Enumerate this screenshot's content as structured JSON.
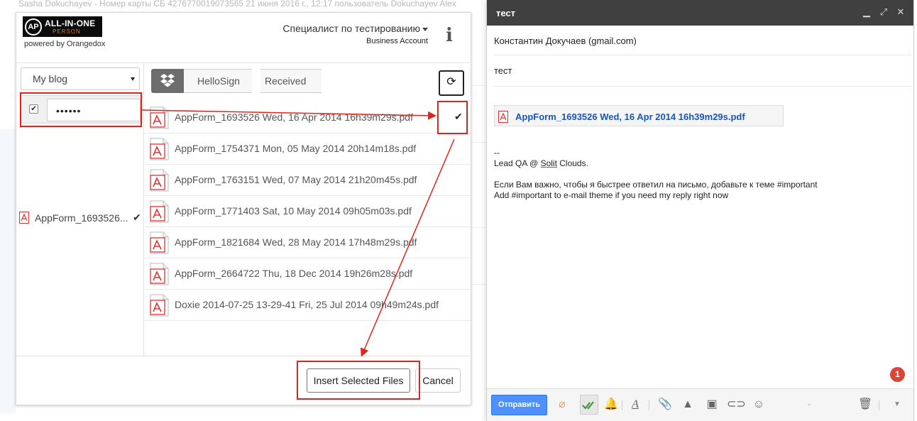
{
  "background": {
    "top_line": "Sasha Dokuchayev - Номер карты СБ 4276770019073565 21 июня 2016 г., 12:17 пользователь Dokuchayev Alex"
  },
  "orangedox": {
    "logo_mark": "AP",
    "logo_title": "ALL-IN-ONE",
    "logo_sub": "PERSON",
    "powered_by": "powered by Orangedox",
    "user_name": "Специалист по тестированию",
    "account_type": "Business Account",
    "blog_select": "My blog",
    "password_value": "••••••",
    "left_file": "AppForm_1693526...",
    "breadcrumb": [
      "HelloSign",
      "Received"
    ],
    "files": [
      {
        "name": "AppForm_1693526 Wed, 16 Apr 2014 16h39m29s.pdf",
        "selected": true
      },
      {
        "name": "AppForm_1754371 Mon, 05 May 2014 20h14m18s.pdf",
        "selected": false
      },
      {
        "name": "AppForm_1763151 Wed, 07 May 2014 21h20m45s.pdf",
        "selected": false
      },
      {
        "name": "AppForm_1771403 Sat, 10 May 2014 09h05m03s.pdf",
        "selected": false
      },
      {
        "name": "AppForm_1821684 Wed, 28 May 2014 17h48m29s.pdf",
        "selected": false
      },
      {
        "name": "AppForm_2664722 Thu, 18 Dec 2014 19h26m28s.pdf",
        "selected": false
      },
      {
        "name": "Doxie 2014-07-25 13-29-41 Fri, 25 Jul 2014 09h49m24s.pdf",
        "selected": false
      }
    ],
    "insert_label": "Insert Selected Files",
    "cancel_label": "Cancel"
  },
  "compose": {
    "title": "тест",
    "to": "Константин Докучаев (gmail.com)",
    "subject": "тест",
    "attachment": "AppForm_1693526 Wed, 16 Apr 2014 16h39m29s.pdf",
    "body": {
      "sig_dashes": "--",
      "sig_line1_pre": "Lead QA @ ",
      "sig_line1_u": "Solit",
      "sig_line1_post": " Clouds.",
      "ru_line": "Если Вам важно, чтобы я быстрее ответил на письмо, добавьте к теме #important",
      "en_line": "Add #important to e-mail theme if you need my reply right now"
    },
    "badge_count": "1",
    "send_label": "Отправить"
  },
  "colors": {
    "annotation": "#e2231a",
    "send_blue": "#4d90fe",
    "link_blue": "#1a55b5",
    "titlebar": "#404040"
  }
}
